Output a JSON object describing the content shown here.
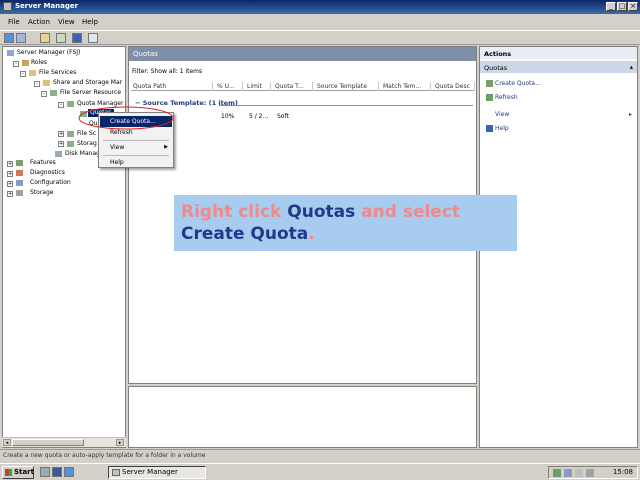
{
  "window": {
    "title": "Server Manager"
  },
  "menubar": [
    "File",
    "Action",
    "View",
    "Help"
  ],
  "tree": {
    "items": [
      {
        "label": "Server Manager (FSJ)",
        "level": 0
      },
      {
        "label": "Roles",
        "level": 1
      },
      {
        "label": "File Services",
        "level": 2
      },
      {
        "label": "Share and Storage Mar",
        "level": 3
      },
      {
        "label": "File Server Resource",
        "level": 4
      },
      {
        "label": "Quota Manager",
        "level": 5
      },
      {
        "label": "Quotas",
        "level": 6
      },
      {
        "label": "Qu",
        "level": 6
      },
      {
        "label": "File Sc",
        "level": 5
      },
      {
        "label": "Storag",
        "level": 5
      },
      {
        "label": "Disk Manag",
        "level": 4
      },
      {
        "label": "Features",
        "level": 1
      },
      {
        "label": "Diagnostics",
        "level": 1
      },
      {
        "label": "Configuration",
        "level": 1
      },
      {
        "label": "Storage",
        "level": 1
      }
    ]
  },
  "center": {
    "title": "Quotas",
    "filter_text": "Filter: Show all: 1 items",
    "columns": [
      "Quota Path",
      "% U...",
      "Limit",
      "Quota T...",
      "Source Template",
      "Match Tem...",
      "Quota Desc"
    ],
    "group_label": "Source Template: (1 item)",
    "row": {
      "used": "10%",
      "limit": "5 / 2...",
      "type": "Soft"
    }
  },
  "context_menu": {
    "items": [
      {
        "label": "Create Quota...",
        "selected": true
      },
      {
        "label": "Refresh"
      },
      {
        "label": "View",
        "submenu": true
      },
      {
        "label": "Help"
      }
    ]
  },
  "actions": {
    "header": "Actions",
    "section": "Quotas",
    "items": [
      "Create Quota...",
      "Refresh",
      "View",
      "Help"
    ]
  },
  "statusbar": {
    "text": "Create a new quota or auto-apply template for a folder in a volume"
  },
  "callout": {
    "part1": "Right click ",
    "part2": "Quotas",
    "part3": " and select",
    "part4": "Create Quota",
    "part5": "."
  },
  "taskbar": {
    "start_label": "Start",
    "task_label": "Server Manager",
    "clock": "15:08"
  },
  "colors": {
    "callout_bg": "#a8cbf0",
    "callout_pink": "#f08a8a",
    "callout_navy": "#1e3a8a",
    "selection": "#0a246a"
  }
}
